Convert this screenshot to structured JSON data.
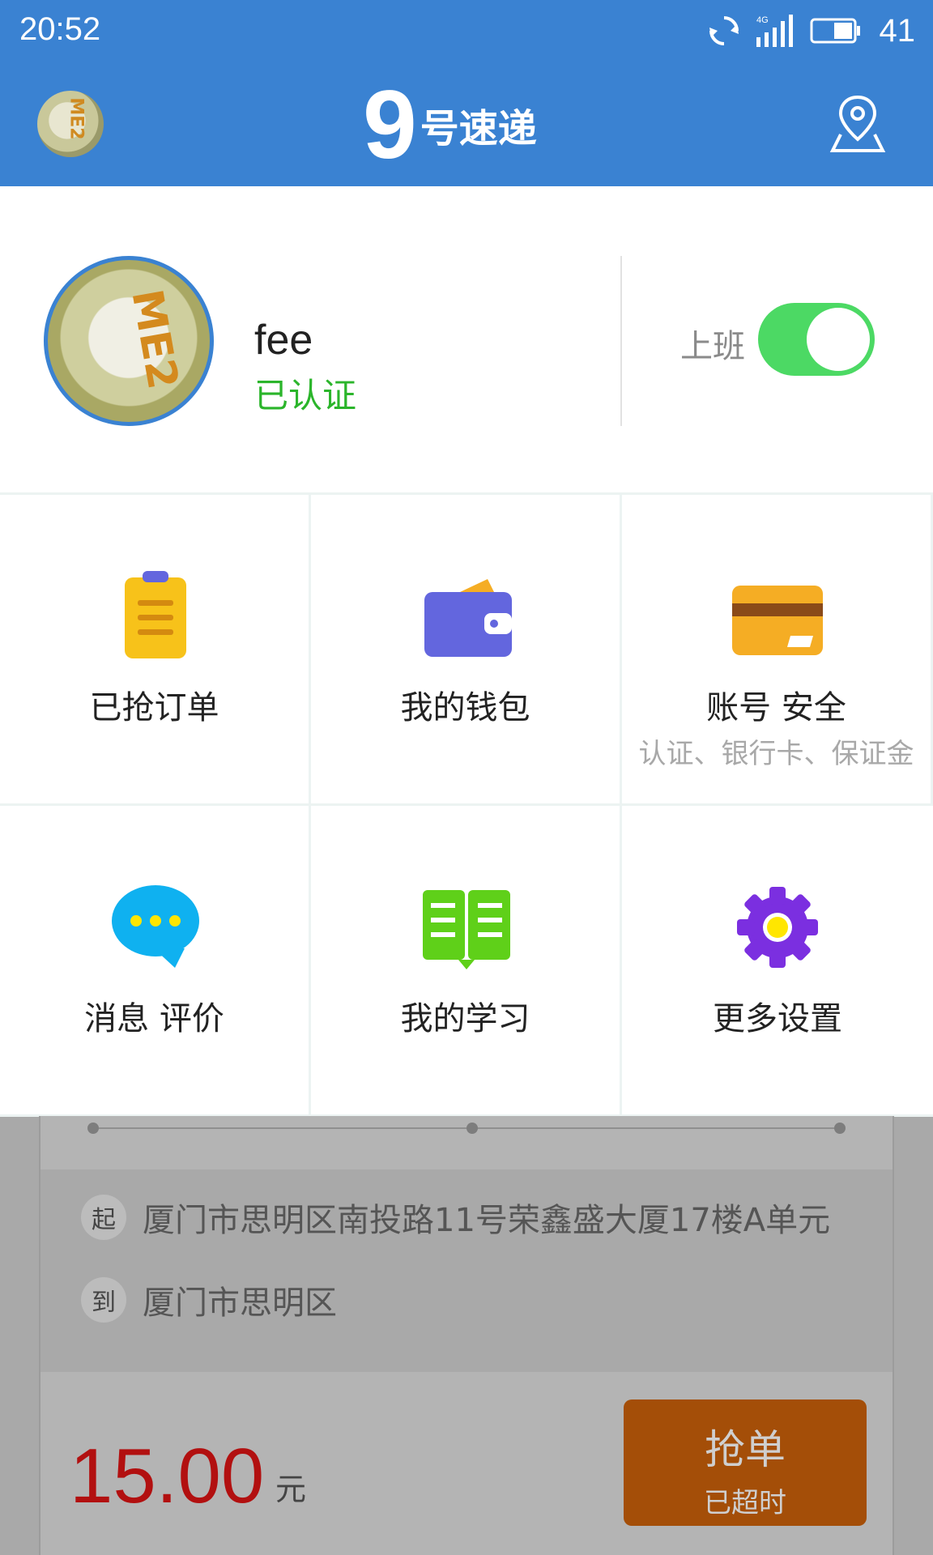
{
  "status_bar": {
    "time": "20:52",
    "network": "4G",
    "battery": "41"
  },
  "header": {
    "avatar_text": "ME2",
    "logo_digit": "9",
    "logo_text": "号速递",
    "location_icon": "location-pin-icon"
  },
  "profile": {
    "avatar_text": "ME2",
    "name": "fee",
    "verified": "已认证",
    "duty_label": "上班",
    "duty_on": true
  },
  "menu": [
    {
      "label": "已抢订单",
      "icon": "clipboard-icon",
      "color": "#f7c21a"
    },
    {
      "label": "我的钱包",
      "icon": "wallet-icon",
      "color": "#6366de"
    },
    {
      "label": "账号 安全",
      "sub": "认证、银行卡、保证金",
      "icon": "card-icon",
      "color": "#f5ad24"
    },
    {
      "label": "消息 评价",
      "icon": "chat-bubble-icon",
      "color": "#0fb1f0"
    },
    {
      "label": "我的学习",
      "icon": "book-icon",
      "color": "#5fd019"
    },
    {
      "label": "更多设置",
      "icon": "gear-icon",
      "color": "#7b2fe0"
    }
  ],
  "order": {
    "from_tag": "起",
    "from": "厦门市思明区南投路11号荣鑫盛大厦17楼A单元",
    "to_tag": "到",
    "to": "厦门市思明区",
    "price": "15.00",
    "unit": "元",
    "grab_label": "抢单",
    "grab_sub": "已超时"
  }
}
